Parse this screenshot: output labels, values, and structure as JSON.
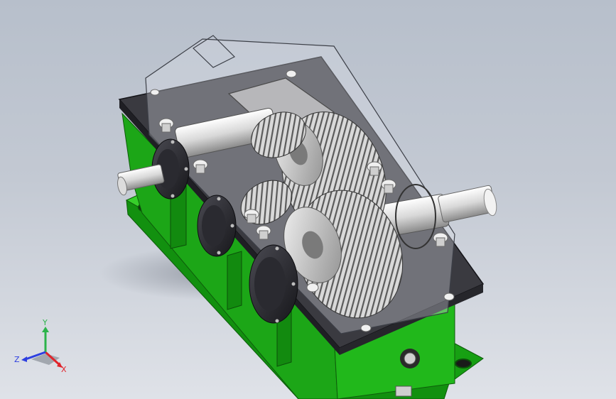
{
  "triad": {
    "x_label": "X",
    "y_label": "Y",
    "z_label": "Z",
    "x_color": "#e0242b",
    "y_color": "#2bb34a",
    "z_color": "#2d3fe0"
  },
  "colors": {
    "base_green": "#23b51c",
    "base_green_dark": "#0f6e0c",
    "flange_dark": "#2d2d33",
    "shaft_silver": "#e6e6e6",
    "gear_grey": "#bcbcbc"
  }
}
